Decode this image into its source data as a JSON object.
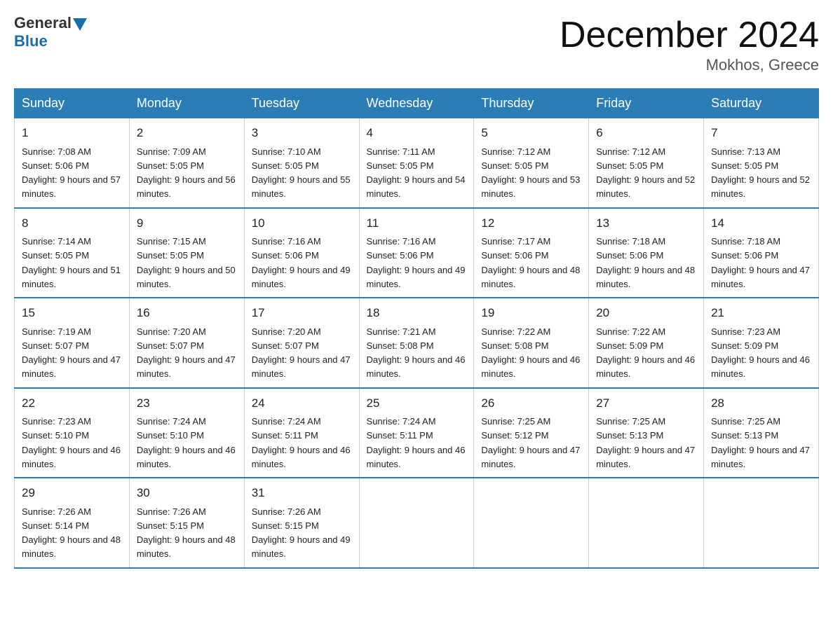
{
  "header": {
    "logo_general": "General",
    "logo_blue": "Blue",
    "month_title": "December 2024",
    "location": "Mokhos, Greece"
  },
  "days_of_week": [
    "Sunday",
    "Monday",
    "Tuesday",
    "Wednesday",
    "Thursday",
    "Friday",
    "Saturday"
  ],
  "weeks": [
    [
      {
        "day": "1",
        "sunrise": "7:08 AM",
        "sunset": "5:06 PM",
        "daylight": "9 hours and 57 minutes."
      },
      {
        "day": "2",
        "sunrise": "7:09 AM",
        "sunset": "5:05 PM",
        "daylight": "9 hours and 56 minutes."
      },
      {
        "day": "3",
        "sunrise": "7:10 AM",
        "sunset": "5:05 PM",
        "daylight": "9 hours and 55 minutes."
      },
      {
        "day": "4",
        "sunrise": "7:11 AM",
        "sunset": "5:05 PM",
        "daylight": "9 hours and 54 minutes."
      },
      {
        "day": "5",
        "sunrise": "7:12 AM",
        "sunset": "5:05 PM",
        "daylight": "9 hours and 53 minutes."
      },
      {
        "day": "6",
        "sunrise": "7:12 AM",
        "sunset": "5:05 PM",
        "daylight": "9 hours and 52 minutes."
      },
      {
        "day": "7",
        "sunrise": "7:13 AM",
        "sunset": "5:05 PM",
        "daylight": "9 hours and 52 minutes."
      }
    ],
    [
      {
        "day": "8",
        "sunrise": "7:14 AM",
        "sunset": "5:05 PM",
        "daylight": "9 hours and 51 minutes."
      },
      {
        "day": "9",
        "sunrise": "7:15 AM",
        "sunset": "5:05 PM",
        "daylight": "9 hours and 50 minutes."
      },
      {
        "day": "10",
        "sunrise": "7:16 AM",
        "sunset": "5:06 PM",
        "daylight": "9 hours and 49 minutes."
      },
      {
        "day": "11",
        "sunrise": "7:16 AM",
        "sunset": "5:06 PM",
        "daylight": "9 hours and 49 minutes."
      },
      {
        "day": "12",
        "sunrise": "7:17 AM",
        "sunset": "5:06 PM",
        "daylight": "9 hours and 48 minutes."
      },
      {
        "day": "13",
        "sunrise": "7:18 AM",
        "sunset": "5:06 PM",
        "daylight": "9 hours and 48 minutes."
      },
      {
        "day": "14",
        "sunrise": "7:18 AM",
        "sunset": "5:06 PM",
        "daylight": "9 hours and 47 minutes."
      }
    ],
    [
      {
        "day": "15",
        "sunrise": "7:19 AM",
        "sunset": "5:07 PM",
        "daylight": "9 hours and 47 minutes."
      },
      {
        "day": "16",
        "sunrise": "7:20 AM",
        "sunset": "5:07 PM",
        "daylight": "9 hours and 47 minutes."
      },
      {
        "day": "17",
        "sunrise": "7:20 AM",
        "sunset": "5:07 PM",
        "daylight": "9 hours and 47 minutes."
      },
      {
        "day": "18",
        "sunrise": "7:21 AM",
        "sunset": "5:08 PM",
        "daylight": "9 hours and 46 minutes."
      },
      {
        "day": "19",
        "sunrise": "7:22 AM",
        "sunset": "5:08 PM",
        "daylight": "9 hours and 46 minutes."
      },
      {
        "day": "20",
        "sunrise": "7:22 AM",
        "sunset": "5:09 PM",
        "daylight": "9 hours and 46 minutes."
      },
      {
        "day": "21",
        "sunrise": "7:23 AM",
        "sunset": "5:09 PM",
        "daylight": "9 hours and 46 minutes."
      }
    ],
    [
      {
        "day": "22",
        "sunrise": "7:23 AM",
        "sunset": "5:10 PM",
        "daylight": "9 hours and 46 minutes."
      },
      {
        "day": "23",
        "sunrise": "7:24 AM",
        "sunset": "5:10 PM",
        "daylight": "9 hours and 46 minutes."
      },
      {
        "day": "24",
        "sunrise": "7:24 AM",
        "sunset": "5:11 PM",
        "daylight": "9 hours and 46 minutes."
      },
      {
        "day": "25",
        "sunrise": "7:24 AM",
        "sunset": "5:11 PM",
        "daylight": "9 hours and 46 minutes."
      },
      {
        "day": "26",
        "sunrise": "7:25 AM",
        "sunset": "5:12 PM",
        "daylight": "9 hours and 47 minutes."
      },
      {
        "day": "27",
        "sunrise": "7:25 AM",
        "sunset": "5:13 PM",
        "daylight": "9 hours and 47 minutes."
      },
      {
        "day": "28",
        "sunrise": "7:25 AM",
        "sunset": "5:13 PM",
        "daylight": "9 hours and 47 minutes."
      }
    ],
    [
      {
        "day": "29",
        "sunrise": "7:26 AM",
        "sunset": "5:14 PM",
        "daylight": "9 hours and 48 minutes."
      },
      {
        "day": "30",
        "sunrise": "7:26 AM",
        "sunset": "5:15 PM",
        "daylight": "9 hours and 48 minutes."
      },
      {
        "day": "31",
        "sunrise": "7:26 AM",
        "sunset": "5:15 PM",
        "daylight": "9 hours and 49 minutes."
      },
      null,
      null,
      null,
      null
    ]
  ]
}
